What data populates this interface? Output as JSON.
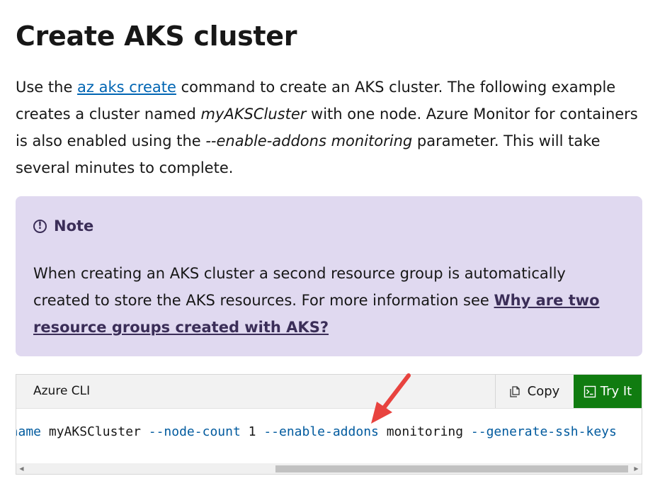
{
  "page": {
    "title": "Create AKS cluster"
  },
  "intro": {
    "text_before_link": "Use the ",
    "link_text": "az aks create",
    "text_after_link": " command to create an AKS cluster. The following example creates a cluster named ",
    "cluster_name": "myAKSCluster",
    "text_mid": " with one node. Azure Monitor for containers is also enabled using the ",
    "param_name": "--enable-addons monitoring",
    "text_end": " parameter. This will take several minutes to complete."
  },
  "note": {
    "heading": "Note",
    "icon": "info-circle-icon",
    "body_text": "When creating an AKS cluster a second resource group is automatically created to store the AKS resources. For more information see ",
    "link_text": "Why are two resource groups created with AKS?",
    "background_color": "#e0d9f0"
  },
  "code_block": {
    "language": "Azure CLI",
    "copy_label": "Copy",
    "try_label": "Try It",
    "tokens": [
      {
        "text": "--name",
        "kind": "param"
      },
      {
        "text": " myAKSCluster ",
        "kind": "plain"
      },
      {
        "text": "--node-count",
        "kind": "param"
      },
      {
        "text": " 1 ",
        "kind": "plain"
      },
      {
        "text": "--enable-addons",
        "kind": "param"
      },
      {
        "text": " monitoring ",
        "kind": "plain"
      },
      {
        "text": "--generate-ssh-keys",
        "kind": "param"
      }
    ],
    "try_color": "#107c10"
  },
  "colors": {
    "link": "#0065b3",
    "annotation_arrow": "#e8433f"
  }
}
